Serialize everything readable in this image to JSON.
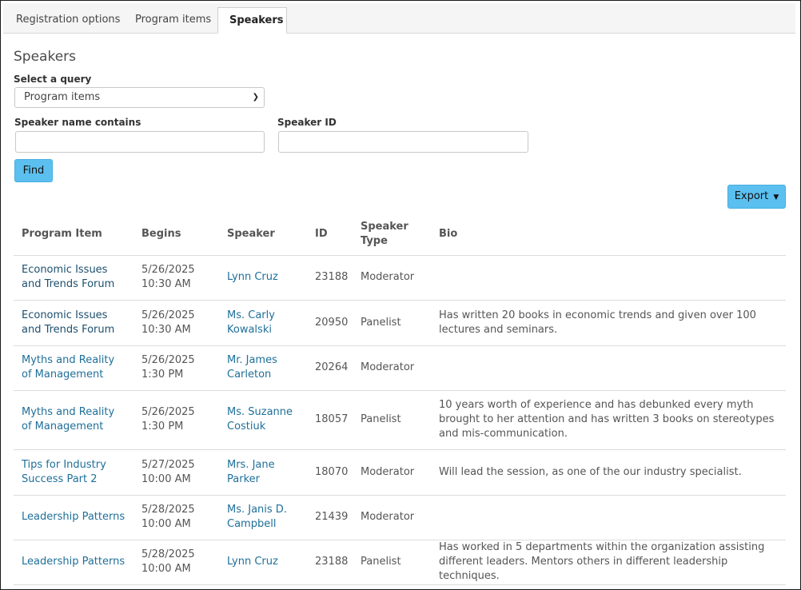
{
  "tabs": [
    {
      "label": "Registration options",
      "active": false
    },
    {
      "label": "Program items",
      "active": false
    },
    {
      "label": "Speakers",
      "active": true
    }
  ],
  "page_title": "Speakers",
  "query": {
    "label": "Select a query",
    "selected": "Program items"
  },
  "filters": {
    "name_label": "Speaker name contains",
    "name_value": "",
    "id_label": "Speaker ID",
    "id_value": ""
  },
  "find_button": "Find",
  "export_button": "Export",
  "table": {
    "columns": [
      "Program Item",
      "Begins",
      "Speaker",
      "ID",
      "Speaker Type",
      "Bio"
    ],
    "rows": [
      {
        "program_item": "Economic Issues and Trends Forum",
        "begins_date": "5/26/2025",
        "begins_time": "10:30 AM",
        "speaker": "Lynn Cruz",
        "id": "23188",
        "type": "Moderator",
        "bio": ""
      },
      {
        "program_item": "Economic Issues and Trends Forum",
        "begins_date": "5/26/2025",
        "begins_time": "10:30 AM",
        "speaker": "Ms. Carly Kowalski",
        "id": "20950",
        "type": "Panelist",
        "bio": "Has written 20 books in economic trends and given over 100 lectures and seminars."
      },
      {
        "program_item": "Myths and Reality of Management",
        "begins_date": "5/26/2025",
        "begins_time": "1:30 PM",
        "speaker": "Mr. James Carleton",
        "id": "20264",
        "type": "Moderator",
        "bio": ""
      },
      {
        "program_item": "Myths and Reality of Management",
        "begins_date": "5/26/2025",
        "begins_time": "1:30 PM",
        "speaker": "Ms. Suzanne Costiuk",
        "id": "18057",
        "type": "Panelist",
        "bio": "10 years worth of experience and has debunked every myth brought to her attention and has written 3 books on stereotypes and mis-communication."
      },
      {
        "program_item": "Tips for Industry Success Part 2",
        "begins_date": "5/27/2025",
        "begins_time": "10:00 AM",
        "speaker": "Mrs. Jane Parker",
        "id": "18070",
        "type": "Moderator",
        "bio": "Will lead the session, as one of the our industry specialist."
      },
      {
        "program_item": "Leadership Patterns",
        "begins_date": "5/28/2025",
        "begins_time": "10:00 AM",
        "speaker": "Ms. Janis D. Campbell",
        "id": "21439",
        "type": "Moderator",
        "bio": ""
      },
      {
        "program_item": "Leadership Patterns",
        "begins_date": "5/28/2025",
        "begins_time": "10:00 AM",
        "speaker": "Lynn Cruz",
        "id": "23188",
        "type": "Panelist",
        "bio": "Has worked in 5 departments within the organization assisting different leaders. Mentors others in different leadership techniques."
      }
    ]
  }
}
